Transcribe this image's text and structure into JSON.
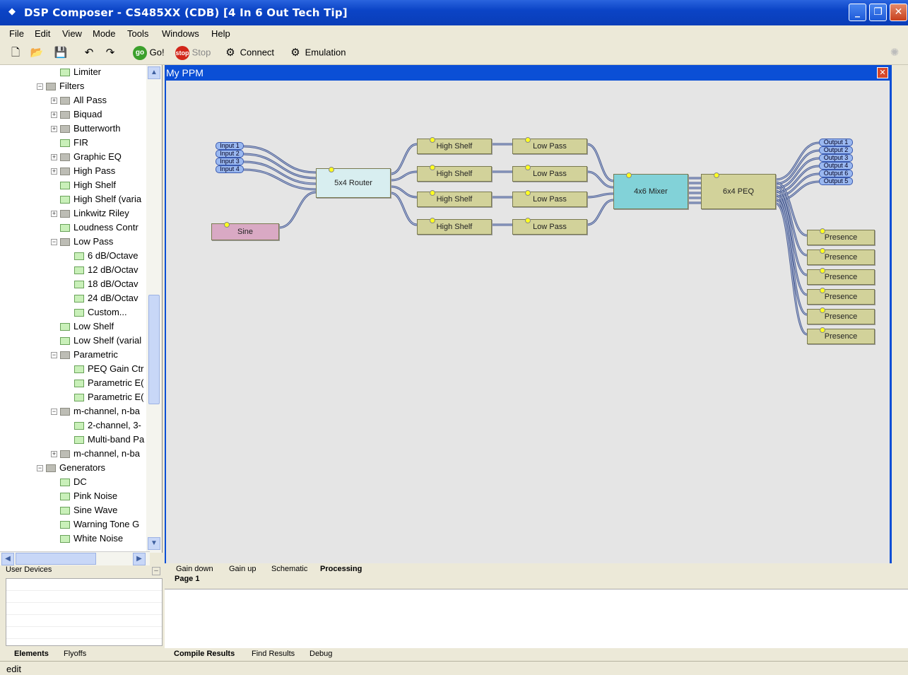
{
  "window": {
    "title": "DSP Composer - CS485XX (CDB) [4 In 6 Out Tech Tip]"
  },
  "menu": [
    "File",
    "Edit",
    "View",
    "Mode",
    "Tools",
    "Windows",
    "Help"
  ],
  "toolbar": {
    "go": "Go!",
    "stop": "Stop",
    "connect": "Connect",
    "emulation": "Emulation"
  },
  "tree": {
    "items": [
      {
        "label": "Limiter",
        "type": "leaf",
        "level": 2
      },
      {
        "label": "Filters",
        "type": "folder-open",
        "level": 1
      },
      {
        "label": "All Pass",
        "type": "folder-closed",
        "level": 2
      },
      {
        "label": "Biquad",
        "type": "folder-closed",
        "level": 2
      },
      {
        "label": "Butterworth",
        "type": "folder-closed",
        "level": 2
      },
      {
        "label": "FIR",
        "type": "leaf",
        "level": 2
      },
      {
        "label": "Graphic EQ",
        "type": "folder-closed",
        "level": 2
      },
      {
        "label": "High Pass",
        "type": "folder-closed",
        "level": 2
      },
      {
        "label": "High Shelf",
        "type": "leaf",
        "level": 2
      },
      {
        "label": "High Shelf (varia",
        "type": "leaf",
        "level": 2
      },
      {
        "label": "Linkwitz Riley",
        "type": "folder-closed",
        "level": 2
      },
      {
        "label": "Loudness Contr",
        "type": "leaf",
        "level": 2
      },
      {
        "label": "Low Pass",
        "type": "folder-open",
        "level": 2
      },
      {
        "label": "6 dB/Octave",
        "type": "leaf",
        "level": 3
      },
      {
        "label": "12 dB/Octav",
        "type": "leaf",
        "level": 3
      },
      {
        "label": "18 dB/Octav",
        "type": "leaf",
        "level": 3
      },
      {
        "label": "24 dB/Octav",
        "type": "leaf",
        "level": 3
      },
      {
        "label": "Custom...",
        "type": "leaf",
        "level": 3
      },
      {
        "label": "Low Shelf",
        "type": "leaf",
        "level": 2
      },
      {
        "label": "Low Shelf (varial",
        "type": "leaf",
        "level": 2
      },
      {
        "label": "Parametric",
        "type": "folder-open",
        "level": 2
      },
      {
        "label": "PEQ Gain Ctr",
        "type": "leaf",
        "level": 3
      },
      {
        "label": "Parametric E(",
        "type": "leaf",
        "level": 3
      },
      {
        "label": "Parametric E(",
        "type": "leaf",
        "level": 3
      },
      {
        "label": "m-channel, n-ba",
        "type": "folder-open",
        "level": 2
      },
      {
        "label": "2-channel, 3-",
        "type": "leaf",
        "level": 3
      },
      {
        "label": "Multi-band Pa",
        "type": "leaf",
        "level": 3
      },
      {
        "label": "m-channel, n-ba",
        "type": "folder-closed",
        "level": 2
      },
      {
        "label": "Generators",
        "type": "folder-open",
        "level": 1
      },
      {
        "label": "DC",
        "type": "leaf",
        "level": 2
      },
      {
        "label": "Pink Noise",
        "type": "leaf",
        "level": 2
      },
      {
        "label": "Sine Wave",
        "type": "leaf",
        "level": 2
      },
      {
        "label": "Warning Tone G",
        "type": "leaf",
        "level": 2
      },
      {
        "label": "White Noise",
        "type": "leaf",
        "level": 2
      }
    ]
  },
  "user_devices": {
    "header": "User Devices"
  },
  "left_tabs": [
    "Elements",
    "Flyoffs"
  ],
  "canvas": {
    "title": "My PPM",
    "inputs": [
      "Input 1",
      "Input 2",
      "Input 3",
      "Input 4"
    ],
    "outputs": [
      "Output 1",
      "Output 2",
      "Output 3",
      "Output 4",
      "Output 6",
      "Output 5"
    ],
    "sine": "Sine",
    "router": "5x4 Router",
    "high_shelf": "High Shelf",
    "low_pass": "Low Pass",
    "mixer": "4x6 Mixer",
    "peq": "6x4 PEQ",
    "presence": "Presence"
  },
  "sheet_tabs": [
    "Gain down",
    "Gain up",
    "Schematic",
    "Processing"
  ],
  "page_tab": "Page 1",
  "output_tabs": [
    "Compile Results",
    "Find Results",
    "Debug"
  ],
  "status": {
    "mode": "edit"
  }
}
